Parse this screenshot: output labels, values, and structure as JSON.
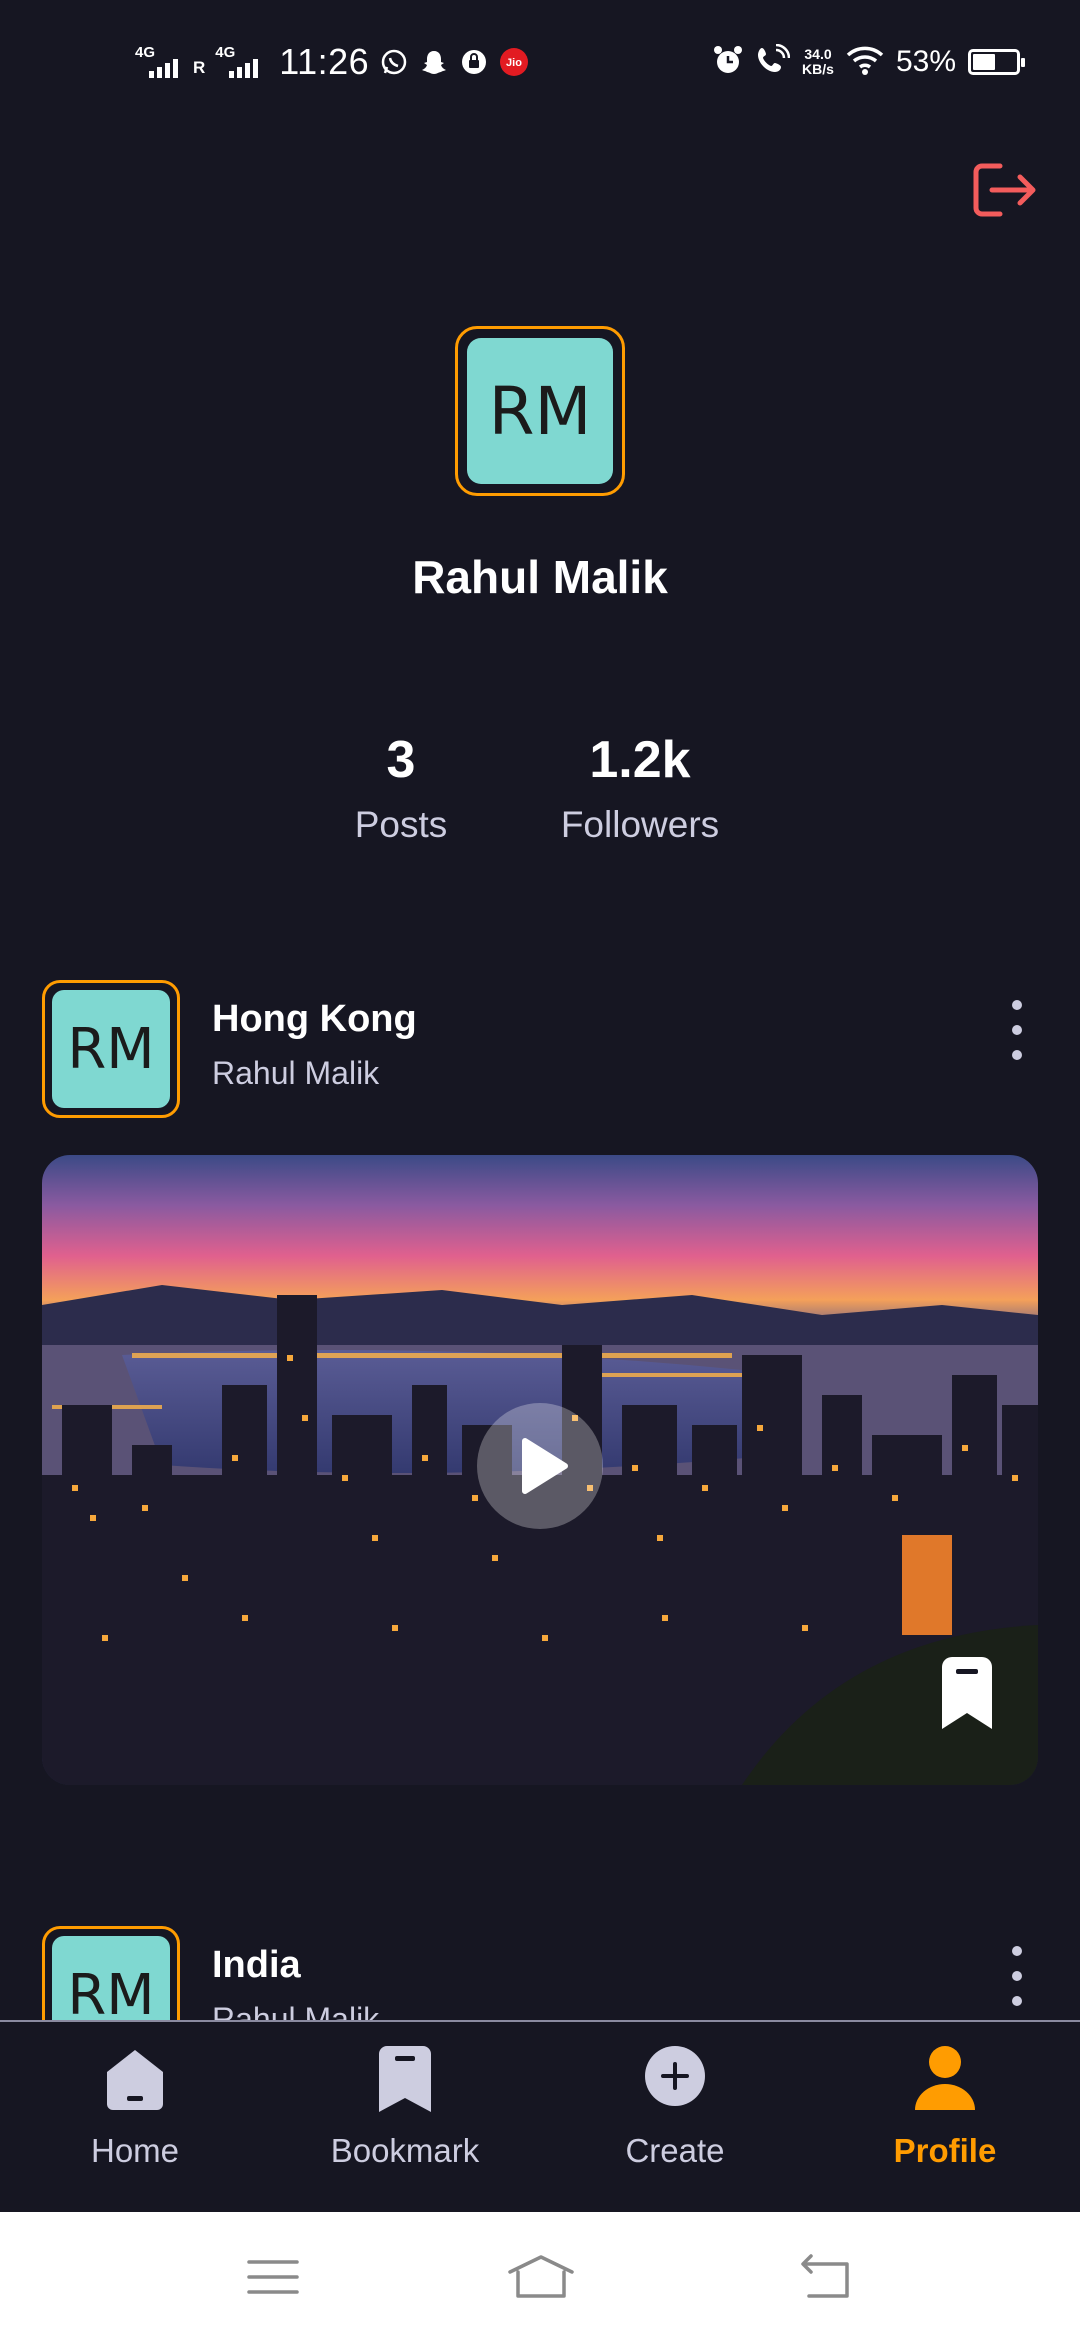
{
  "status_bar": {
    "network_1": "4G",
    "roaming": "R",
    "network_2": "4G",
    "time": "11:26",
    "speed_value": "34.0",
    "speed_unit": "KB/s",
    "battery_pct": "53%",
    "battery_level": 0.53,
    "notification_icons": [
      "whatsapp-icon",
      "snapchat-icon",
      "lock-app-icon",
      "jio-icon"
    ],
    "system_icons": [
      "alarm-icon",
      "wifi-call-icon",
      "wifi-icon"
    ],
    "jio_label": "Jio"
  },
  "header": {
    "logout_icon": "logout-icon"
  },
  "profile": {
    "initials": "RM",
    "name": "Rahul Malik",
    "stats": {
      "posts_value": "3",
      "posts_label": "Posts",
      "followers_value": "1.2k",
      "followers_label": "Followers"
    }
  },
  "posts": [
    {
      "initials": "RM",
      "title": "Hong Kong",
      "author": "Rahul Malik",
      "media": "city-skyline-video-thumbnail"
    },
    {
      "initials": "RM",
      "title": "India",
      "author": "Rahul Malik"
    }
  ],
  "tabs": [
    {
      "label": "Home",
      "icon": "home-icon"
    },
    {
      "label": "Bookmark",
      "icon": "bookmark-icon"
    },
    {
      "label": "Create",
      "icon": "plus-icon"
    },
    {
      "label": "Profile",
      "icon": "profile-icon",
      "active": true
    }
  ],
  "colors": {
    "background": "#161622",
    "accent": "#ff9c01",
    "avatar_bg": "#7fd8d1",
    "muted_text": "#cdcde0",
    "logout": "#f35c5c"
  },
  "system_nav": [
    "menu-icon",
    "home-outline-icon",
    "back-icon"
  ]
}
